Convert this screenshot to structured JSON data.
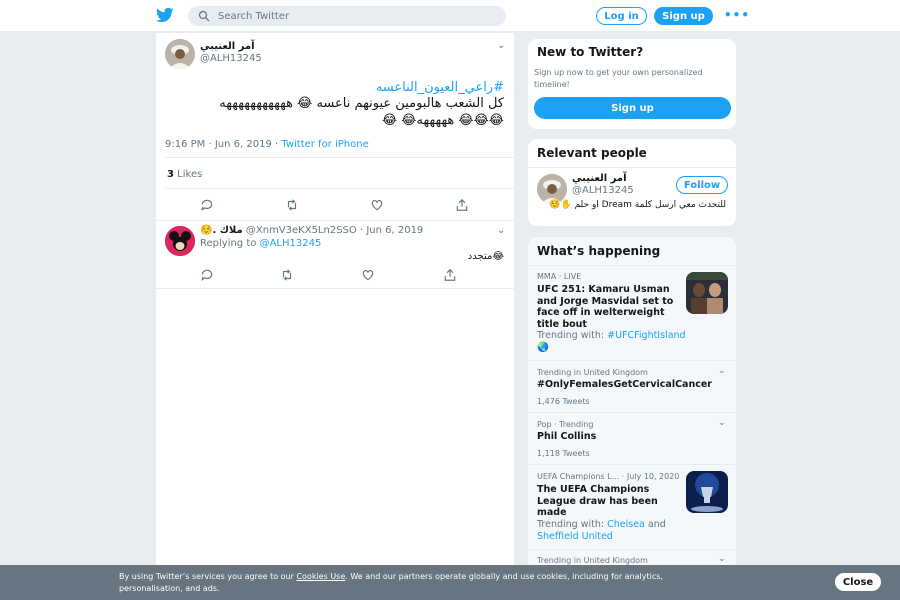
{
  "header": {
    "search_placeholder": "Search Twitter",
    "login_label": "Log in",
    "signup_label": "Sign up",
    "more_label": "•••"
  },
  "tweet": {
    "author_name": "آمر العنيبي",
    "author_handle": "@ALH13245",
    "hashtag": "#راعي_العيون_الناعسه",
    "line1": "كل الشعب هالبومين عيونهم ناعسه 😂 هههههههههههه",
    "line2": "😂😂😂 هههههه😂 😂",
    "time": "9:16 PM · Jun 6, 2019",
    "via": "Twitter for iPhone",
    "likes_count": "3",
    "likes_label": "Likes"
  },
  "reply": {
    "author_name": "☺️. ملاك",
    "author_handle": "@XnmV3eKX5Ln2SSO",
    "date": "· Jun 6, 2019",
    "replying_to_label": "Replying to",
    "replying_to_handle": "@ALH13245",
    "text": "😂متجدد"
  },
  "new_to_twitter": {
    "title": "New to Twitter?",
    "subtitle": "Sign up now to get your own personalized timeline!",
    "signup_label": "Sign up"
  },
  "relevant_people": {
    "title": "Relevant people",
    "name": "آمر العنيبي",
    "handle": "@ALH13245",
    "follow_label": "Follow",
    "bio": "للتحدث معي ارسل كلمة Dream او حلم ✋☺️"
  },
  "whats_happening": {
    "title": "What’s happening",
    "trends": [
      {
        "category": "MMA · LIVE",
        "title": "UFC 251: Kamaru Usman and Jorge Masvidal set to face off in welterweight title bout",
        "trending_with_label": "Trending with:",
        "trending_with": "#UFCFightIsland"
      },
      {
        "category": "Trending in United Kingdom",
        "title": "#OnlyFemalesGetCervicalCancer",
        "count": "1,476 Tweets"
      },
      {
        "category": "Pop · Trending",
        "title": "Phil Collins",
        "count": "1,118 Tweets"
      },
      {
        "category": "UEFA Champions L... · July 10, 2020",
        "title": "The UEFA Champions League draw has been made",
        "trending_with_label": "Trending with:",
        "trending_with_a": "Chelsea",
        "trending_with_and": "and",
        "trending_with_b": "Sheffield United"
      },
      {
        "category": "Trending in United Kingdom"
      }
    ]
  },
  "cookie": {
    "text_before": "By using Twitter’s services you agree to our",
    "link": "Cookies Use",
    "text_after": ". We and our partners operate globally and use cookies, including for analytics, personalisation, and ads.",
    "close_label": "Close"
  },
  "colors": {
    "accent": "#1da1f2",
    "background": "#e6ecf0",
    "muted": "#657786"
  }
}
